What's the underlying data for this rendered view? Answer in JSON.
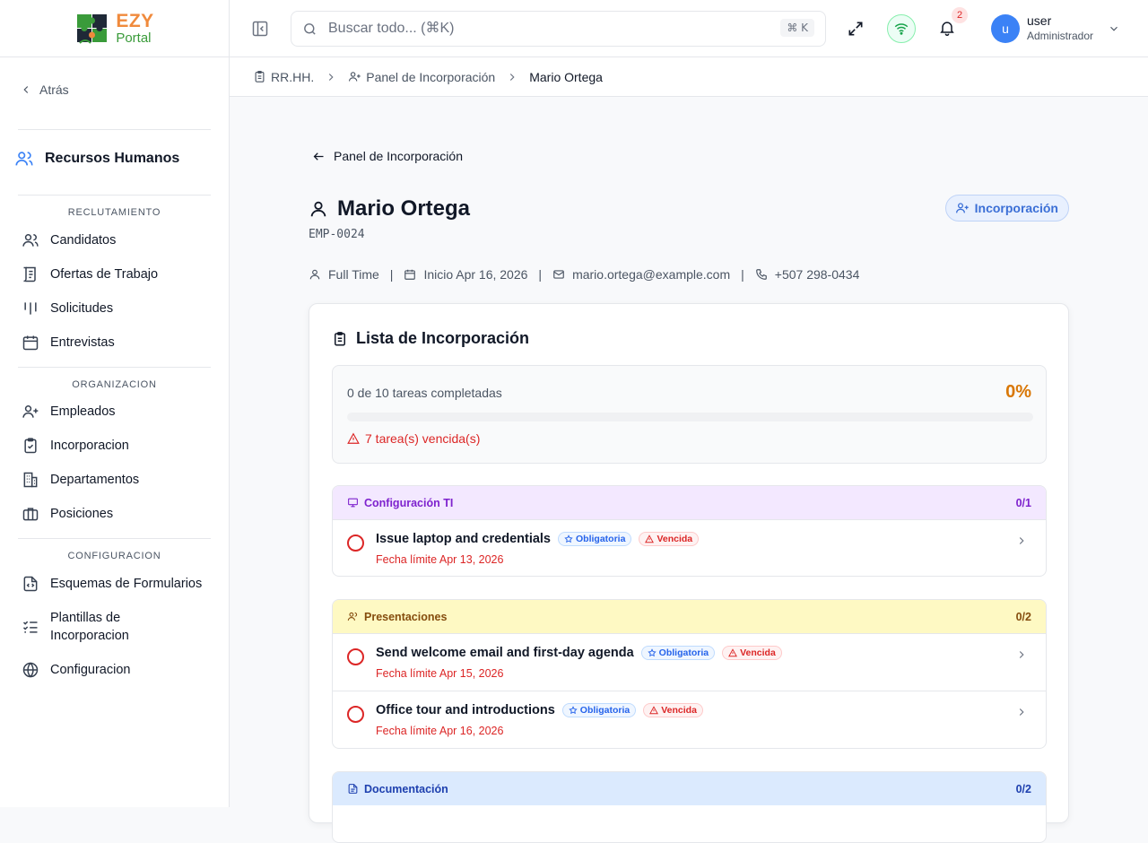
{
  "app": {
    "brand_top": "EZY",
    "brand_bottom": "Portal"
  },
  "sidebar": {
    "back_label": "Atrás",
    "module_title": "Recursos Humanos",
    "sections": [
      {
        "label": "RECLUTAMIENTO",
        "items": [
          "Candidatos",
          "Ofertas de Trabajo",
          "Solicitudes",
          "Entrevistas"
        ]
      },
      {
        "label": "ORGANIZACION",
        "items": [
          "Empleados",
          "Incorporacion",
          "Departamentos",
          "Posiciones"
        ]
      },
      {
        "label": "CONFIGURACION",
        "items": [
          "Esquemas de Formularios",
          "Plantillas de Incorporacion",
          "Configuracion"
        ]
      }
    ]
  },
  "topbar": {
    "search_placeholder": "Buscar todo... (⌘K)",
    "search_kbd": "⌘ K",
    "notification_count": "2",
    "user_initial": "u",
    "user_name": "user",
    "user_role": "Administrador"
  },
  "breadcrumb": [
    "RR.HH.",
    "Panel de Incorporación",
    "Mario Ortega"
  ],
  "page": {
    "back_link": "Panel de Incorporación",
    "employee_name": "Mario Ortega",
    "employee_id": "EMP-0024",
    "status_badge": "Incorporación",
    "meta": {
      "employment_type": "Full Time",
      "start": "Inicio Apr 16, 2026",
      "email": "mario.ortega@example.com",
      "phone": "+507 298-0434",
      "separator": "|"
    }
  },
  "checklist": {
    "title": "Lista de Incorporación",
    "progress_text": "0 de 10 tareas completadas",
    "percent": "0%",
    "progress_fraction": 0,
    "overdue_text": "7 tarea(s) vencida(s)",
    "badge_required": "Obligatoria",
    "badge_overdue": "Vencida",
    "groups": [
      {
        "name": "Configuración TI",
        "count": "0/1",
        "tasks": [
          {
            "title": "Issue laptop and credentials",
            "due": "Fecha límite Apr 13, 2026"
          }
        ]
      },
      {
        "name": "Presentaciones",
        "count": "0/2",
        "tasks": [
          {
            "title": "Send welcome email and first-day agenda",
            "due": "Fecha límite Apr 15, 2026"
          },
          {
            "title": "Office tour and introductions",
            "due": "Fecha límite Apr 16, 2026"
          }
        ]
      },
      {
        "name": "Documentación",
        "count": "0/2",
        "tasks": []
      }
    ]
  },
  "colors": {
    "accent": "#3b82f6",
    "warning_orange": "#d97706",
    "danger": "#dc2626"
  }
}
